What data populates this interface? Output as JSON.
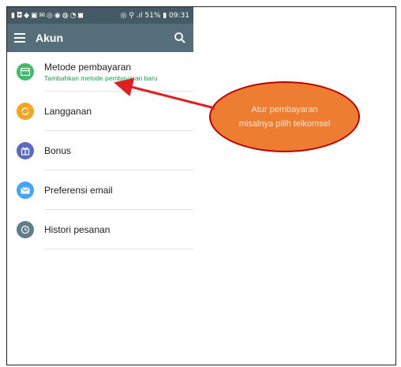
{
  "status_bar": {
    "icons": "▮◘◆▣✉◎◉◍◔◼",
    "right_text": "◎ ⚲ .ıl 51% ▮ 09:31"
  },
  "app_bar": {
    "title": "Akun",
    "menu_icon": "hamburger-icon",
    "search_icon": "search-icon"
  },
  "list": {
    "items": [
      {
        "label": "Metode pembayaran",
        "sublabel": "Tambahkan metode pembayaran baru",
        "icon": "credit-card-icon",
        "color": "#43b96a"
      },
      {
        "label": "Langganan",
        "sublabel": "",
        "icon": "refresh-icon",
        "color": "#f4a623"
      },
      {
        "label": "Bonus",
        "sublabel": "",
        "icon": "gift-icon",
        "color": "#5c6bc0"
      },
      {
        "label": "Preferensi email",
        "sublabel": "",
        "icon": "mail-icon",
        "color": "#42a5f5"
      },
      {
        "label": "Histori pesanan",
        "sublabel": "",
        "icon": "history-icon",
        "color": "#607d8b"
      }
    ]
  },
  "annotation": {
    "text": "Atur pembayaran misalnya pilih telkomsel",
    "fill": "#ed7d31",
    "border": "#c00000",
    "arrow_color": "#e02020"
  }
}
